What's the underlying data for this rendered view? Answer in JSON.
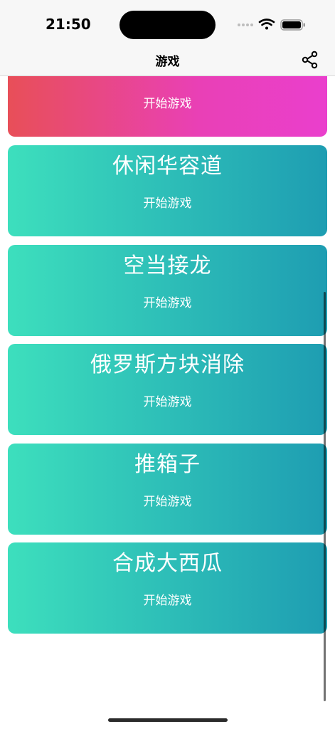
{
  "status_bar": {
    "time": "21:50"
  },
  "nav": {
    "title": "游戏",
    "share_icon": "share-icon"
  },
  "games": [
    {
      "title": "",
      "action": "开始游戏",
      "color": "pink"
    },
    {
      "title": "休闲华容道",
      "action": "开始游戏",
      "color": "teal"
    },
    {
      "title": "空当接龙",
      "action": "开始游戏",
      "color": "teal"
    },
    {
      "title": "俄罗斯方块消除",
      "action": "开始游戏",
      "color": "teal"
    },
    {
      "title": "推箱子",
      "action": "开始游戏",
      "color": "teal"
    },
    {
      "title": "合成大西瓜",
      "action": "开始游戏",
      "color": "teal"
    }
  ],
  "colors": {
    "teal_start": "#3ddfbd",
    "teal_end": "#1e9db2",
    "pink_start": "#e84f58",
    "pink_end": "#ea3fcd"
  }
}
